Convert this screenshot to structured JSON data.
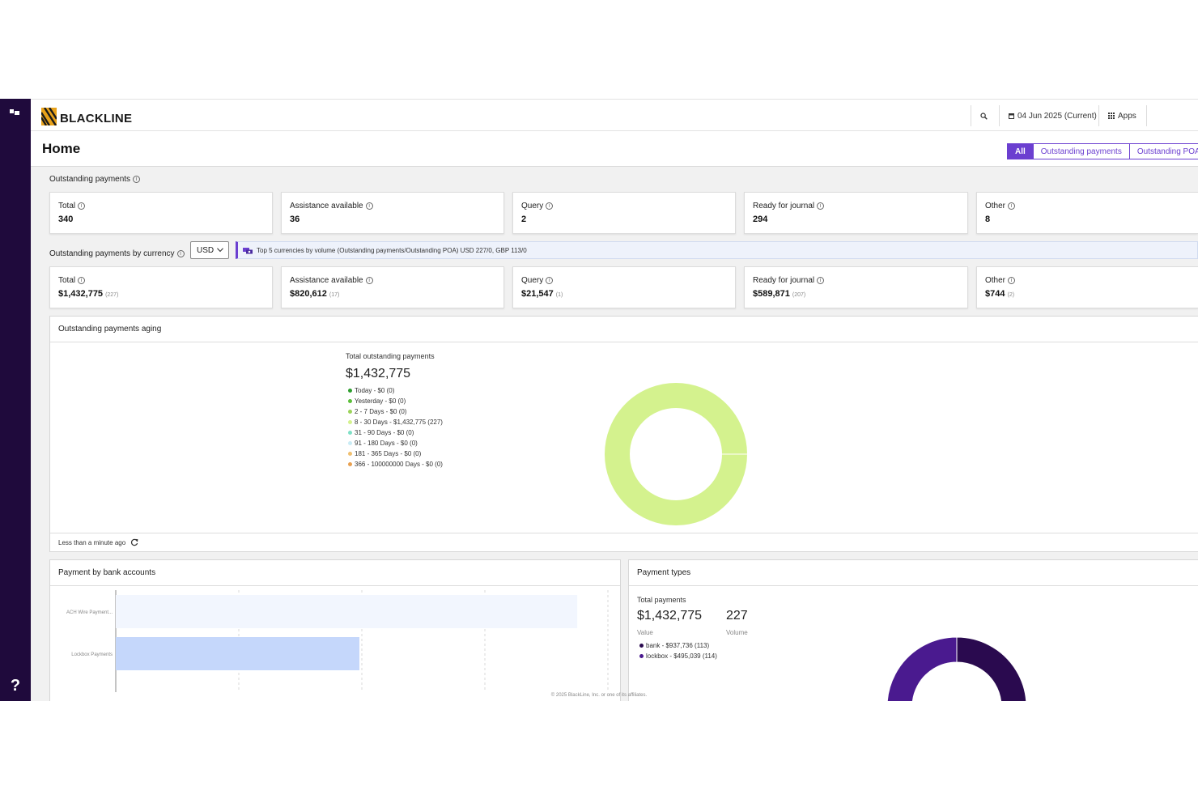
{
  "brand": {
    "name": "BLACKLINE",
    "accent": "#6b3fd0",
    "rail_color": "#1f0a3c"
  },
  "topbar": {
    "date_label": "04 Jun 2025 (Current)",
    "apps_label": "Apps"
  },
  "page": {
    "title": "Home"
  },
  "filters": {
    "tabs": [
      "All",
      "Outstanding payments",
      "Outstanding POA"
    ],
    "active": "All"
  },
  "outstanding": {
    "label": "Outstanding payments",
    "cards": [
      {
        "label": "Total",
        "value": "340"
      },
      {
        "label": "Assistance available",
        "value": "36"
      },
      {
        "label": "Query",
        "value": "2"
      },
      {
        "label": "Ready for journal",
        "value": "294"
      },
      {
        "label": "Other",
        "value": "8"
      }
    ]
  },
  "by_currency": {
    "label": "Outstanding payments by currency",
    "currency": "USD",
    "banner": "Top 5 currencies by volume (Outstanding payments/Outstanding POA) USD 227/0, GBP 113/0",
    "cards": [
      {
        "label": "Total",
        "value": "$1,432,775",
        "count": "(227)"
      },
      {
        "label": "Assistance available",
        "value": "$820,612",
        "count": "(17)"
      },
      {
        "label": "Query",
        "value": "$21,547",
        "count": "(1)"
      },
      {
        "label": "Ready for journal",
        "value": "$589,871",
        "count": "(207)"
      },
      {
        "label": "Other",
        "value": "$744",
        "count": "(2)"
      }
    ]
  },
  "aging": {
    "title": "Outstanding payments aging",
    "legend_title": "Total outstanding payments",
    "total": "$1,432,775",
    "items": [
      {
        "label": "Today - $0 (0)",
        "color": "#2e9e2e"
      },
      {
        "label": "Yesterday - $0 (0)",
        "color": "#5cbf3a"
      },
      {
        "label": "2 - 7 Days - $0 (0)",
        "color": "#9bd35a"
      },
      {
        "label": "8 - 30 Days - $1,432,775 (227)",
        "color": "#d4f28e"
      },
      {
        "label": "31 - 90 Days - $0 (0)",
        "color": "#7fe0c6"
      },
      {
        "label": "91 - 180 Days - $0 (0)",
        "color": "#c9ecf5"
      },
      {
        "label": "181 - 365 Days - $0 (0)",
        "color": "#f0c070"
      },
      {
        "label": "366 - 100000000 Days - $0 (0)",
        "color": "#e8a050"
      }
    ],
    "updated": "Less than a minute ago"
  },
  "bank_accounts": {
    "title": "Payment by bank accounts"
  },
  "payment_types": {
    "title": "Payment types",
    "heading": "Total payments",
    "value": "$1,432,775",
    "value_label": "Value",
    "volume": "227",
    "volume_label": "Volume",
    "items": [
      {
        "label": "bank - $937,736 (113)",
        "color": "#2a0a4f"
      },
      {
        "label": "lockbox - $495,039 (114)",
        "color": "#4a1a8f"
      }
    ]
  },
  "chart_data": [
    {
      "type": "pie",
      "categories": [
        "Today",
        "Yesterday",
        "2 - 7 Days",
        "8 - 30 Days",
        "31 - 90 Days",
        "91 - 180 Days",
        "181 - 365 Days",
        "366 - 100000000 Days"
      ],
      "values": [
        0,
        0,
        0,
        1432775,
        0,
        0,
        0,
        0
      ],
      "title": "Total outstanding payments"
    },
    {
      "type": "bar",
      "orientation": "horizontal",
      "categories": [
        "ACH Wire Payment...",
        "Lockbox Payments"
      ],
      "values": [
        937736,
        495039
      ],
      "colors": [
        "#f2f6fe",
        "#c5d7fb"
      ],
      "xlim": [
        0,
        1000000
      ]
    },
    {
      "type": "pie",
      "categories": [
        "bank",
        "lockbox"
      ],
      "values": [
        937736,
        495039
      ],
      "title": "Total payments"
    }
  ],
  "footer": "© 2025 BlackLine, Inc. or one of its affiliates."
}
